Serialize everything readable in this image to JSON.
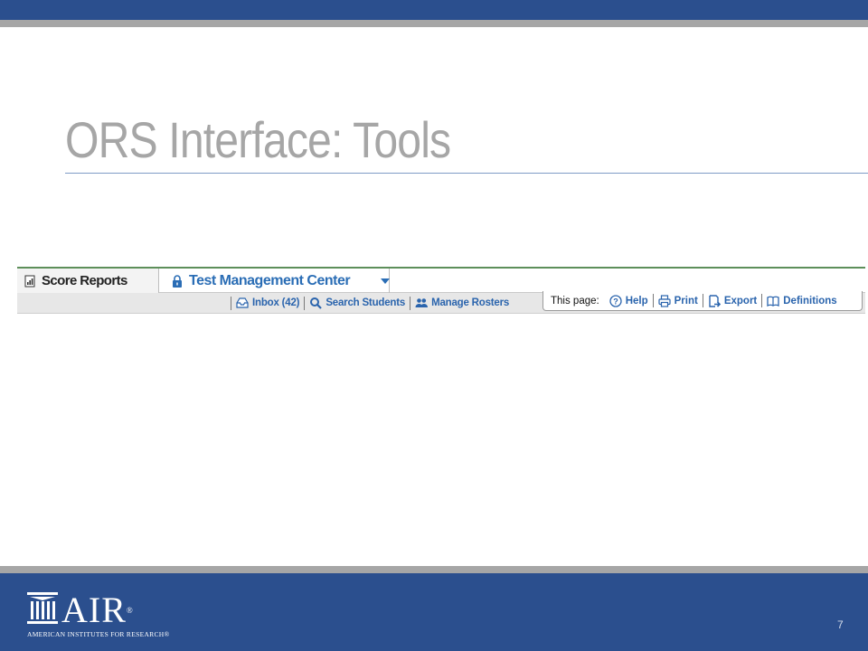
{
  "slide": {
    "title": "ORS Interface: Tools",
    "page_number": "7"
  },
  "ors_toolbar": {
    "tabs": [
      {
        "label": "Score Reports",
        "icon": "report-icon"
      },
      {
        "label": "Test Management Center",
        "icon": "lock-icon"
      }
    ],
    "nav_links": [
      {
        "label": "Inbox (42)",
        "icon": "inbox-icon"
      },
      {
        "label": "Search Students",
        "icon": "search-icon"
      },
      {
        "label": "Manage Rosters",
        "icon": "users-icon"
      }
    ],
    "this_page": {
      "label": "This page:",
      "links": [
        {
          "label": "Help",
          "icon": "help-icon"
        },
        {
          "label": "Print",
          "icon": "print-icon"
        },
        {
          "label": "Export",
          "icon": "export-icon"
        },
        {
          "label": "Definitions",
          "icon": "book-icon"
        }
      ]
    }
  },
  "footer": {
    "logo_text": "AIR",
    "logo_mark": "®",
    "logo_subtitle": "AMERICAN INSTITUTES FOR RESEARCH®"
  },
  "colors": {
    "band": "#2b4f8e",
    "grey_bar": "#a6a6a6",
    "title": "#a6a6a6",
    "link_blue": "#2a64ad",
    "tab_green_rule": "#5d8f5a"
  }
}
